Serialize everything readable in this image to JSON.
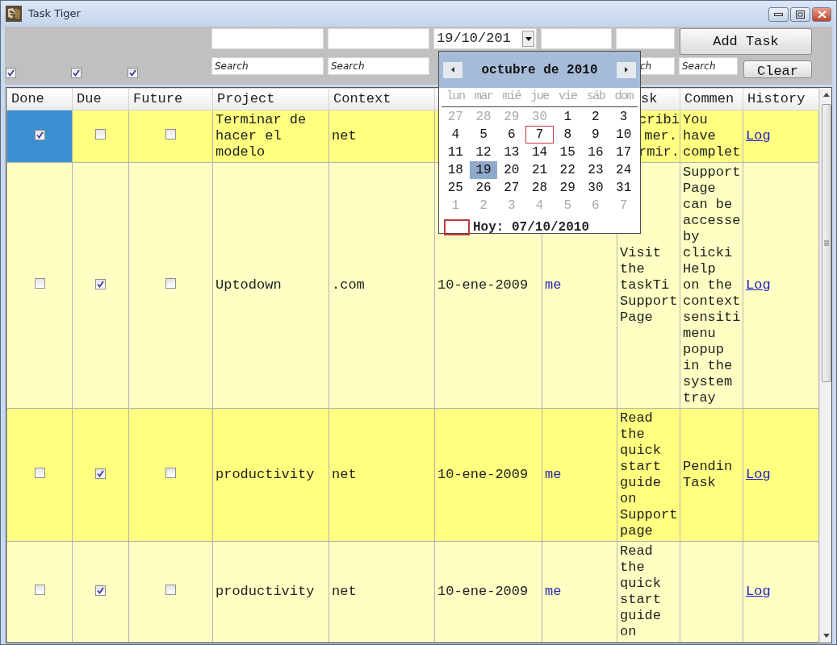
{
  "window": {
    "title": "Task Tiger"
  },
  "toolbar": {
    "filters": [
      {
        "checked": true
      },
      {
        "checked": true
      },
      {
        "checked": true
      }
    ],
    "date_field": {
      "value": "19/10/201"
    },
    "add_button": "Add Task",
    "search_fields": [
      {
        "placeholder": "Search"
      },
      {
        "placeholder": "Search"
      },
      {
        "placeholder": "ch"
      },
      {
        "placeholder": "Search"
      }
    ],
    "clear_button": "Clear"
  },
  "table": {
    "columns": {
      "done": "Done",
      "due": "Due",
      "future": "Future",
      "project": "Project",
      "context": "Context",
      "column_8": "sk",
      "comment": "Commen",
      "history": "History"
    },
    "rows": [
      {
        "selected": true,
        "done": true,
        "due": false,
        "future": false,
        "project": "Terminar de hacer el modelo",
        "context": "net",
        "column_8": "cribi mer. rmir.",
        "comment": "You have complet",
        "history": "Log"
      },
      {
        "selected": false,
        "done": false,
        "due": true,
        "future": false,
        "project": "Uptodown",
        "context": ".com",
        "date": "10-ene-2009",
        "owner": "me",
        "column_8": "Visit the taskTi Support Page",
        "comment": "Support Page can be accesse by clicki Help on the context sensiti menu popup in the system tray",
        "history": "Log"
      },
      {
        "selected": false,
        "done": false,
        "due": true,
        "future": false,
        "project": "productivity",
        "context": "net",
        "date": "10-ene-2009",
        "owner": "me",
        "column_8": "Read the quick start guide on Support page",
        "comment": "Pendin Task",
        "history": "Log"
      },
      {
        "selected": false,
        "done": false,
        "due": true,
        "future": false,
        "project": "productivity",
        "context": "net",
        "date": "10-ene-2009",
        "owner": "me",
        "column_8": "Read the quick start guide on",
        "history": "Log"
      }
    ]
  },
  "calendar": {
    "title": "octubre de 2010",
    "weekdays": [
      "lun",
      "mar",
      "mié",
      "jue",
      "vie",
      "sáb",
      "dom"
    ],
    "days": [
      {
        "label": "27",
        "other_month": true,
        "today": false,
        "selected": false
      },
      {
        "label": "28",
        "other_month": true,
        "today": false,
        "selected": false
      },
      {
        "label": "29",
        "other_month": true,
        "today": false,
        "selected": false
      },
      {
        "label": "30",
        "other_month": true,
        "today": false,
        "selected": false
      },
      {
        "label": "1",
        "other_month": false,
        "today": false,
        "selected": false
      },
      {
        "label": "2",
        "other_month": false,
        "today": false,
        "selected": false
      },
      {
        "label": "3",
        "other_month": false,
        "today": false,
        "selected": false
      },
      {
        "label": "4",
        "other_month": false,
        "today": false,
        "selected": false
      },
      {
        "label": "5",
        "other_month": false,
        "today": false,
        "selected": false
      },
      {
        "label": "6",
        "other_month": false,
        "today": false,
        "selected": false
      },
      {
        "label": "7",
        "other_month": false,
        "today": true,
        "selected": false
      },
      {
        "label": "8",
        "other_month": false,
        "today": false,
        "selected": false
      },
      {
        "label": "9",
        "other_month": false,
        "today": false,
        "selected": false
      },
      {
        "label": "10",
        "other_month": false,
        "today": false,
        "selected": false
      },
      {
        "label": "11",
        "other_month": false,
        "today": false,
        "selected": false
      },
      {
        "label": "12",
        "other_month": false,
        "today": false,
        "selected": false
      },
      {
        "label": "13",
        "other_month": false,
        "today": false,
        "selected": false
      },
      {
        "label": "14",
        "other_month": false,
        "today": false,
        "selected": false
      },
      {
        "label": "15",
        "other_month": false,
        "today": false,
        "selected": false
      },
      {
        "label": "16",
        "other_month": false,
        "today": false,
        "selected": false
      },
      {
        "label": "17",
        "other_month": false,
        "today": false,
        "selected": false
      },
      {
        "label": "18",
        "other_month": false,
        "today": false,
        "selected": false
      },
      {
        "label": "19",
        "other_month": false,
        "today": false,
        "selected": true
      },
      {
        "label": "20",
        "other_month": false,
        "today": false,
        "selected": false
      },
      {
        "label": "21",
        "other_month": false,
        "today": false,
        "selected": false
      },
      {
        "label": "22",
        "other_month": false,
        "today": false,
        "selected": false
      },
      {
        "label": "23",
        "other_month": false,
        "today": false,
        "selected": false
      },
      {
        "label": "24",
        "other_month": false,
        "today": false,
        "selected": false
      },
      {
        "label": "25",
        "other_month": false,
        "today": false,
        "selected": false
      },
      {
        "label": "26",
        "other_month": false,
        "today": false,
        "selected": false
      },
      {
        "label": "27",
        "other_month": false,
        "today": false,
        "selected": false
      },
      {
        "label": "28",
        "other_month": false,
        "today": false,
        "selected": false
      },
      {
        "label": "29",
        "other_month": false,
        "today": false,
        "selected": false
      },
      {
        "label": "30",
        "other_month": false,
        "today": false,
        "selected": false
      },
      {
        "label": "31",
        "other_month": false,
        "today": false,
        "selected": false
      },
      {
        "label": "1",
        "other_month": true,
        "today": false,
        "selected": false
      },
      {
        "label": "2",
        "other_month": true,
        "today": false,
        "selected": false
      },
      {
        "label": "3",
        "other_month": true,
        "today": false,
        "selected": false
      },
      {
        "label": "4",
        "other_month": true,
        "today": false,
        "selected": false
      },
      {
        "label": "5",
        "other_month": true,
        "today": false,
        "selected": false
      },
      {
        "label": "6",
        "other_month": true,
        "today": false,
        "selected": false
      },
      {
        "label": "7",
        "other_month": true,
        "today": false,
        "selected": false
      }
    ],
    "today_label": "Hoy: 07/10/2010"
  }
}
